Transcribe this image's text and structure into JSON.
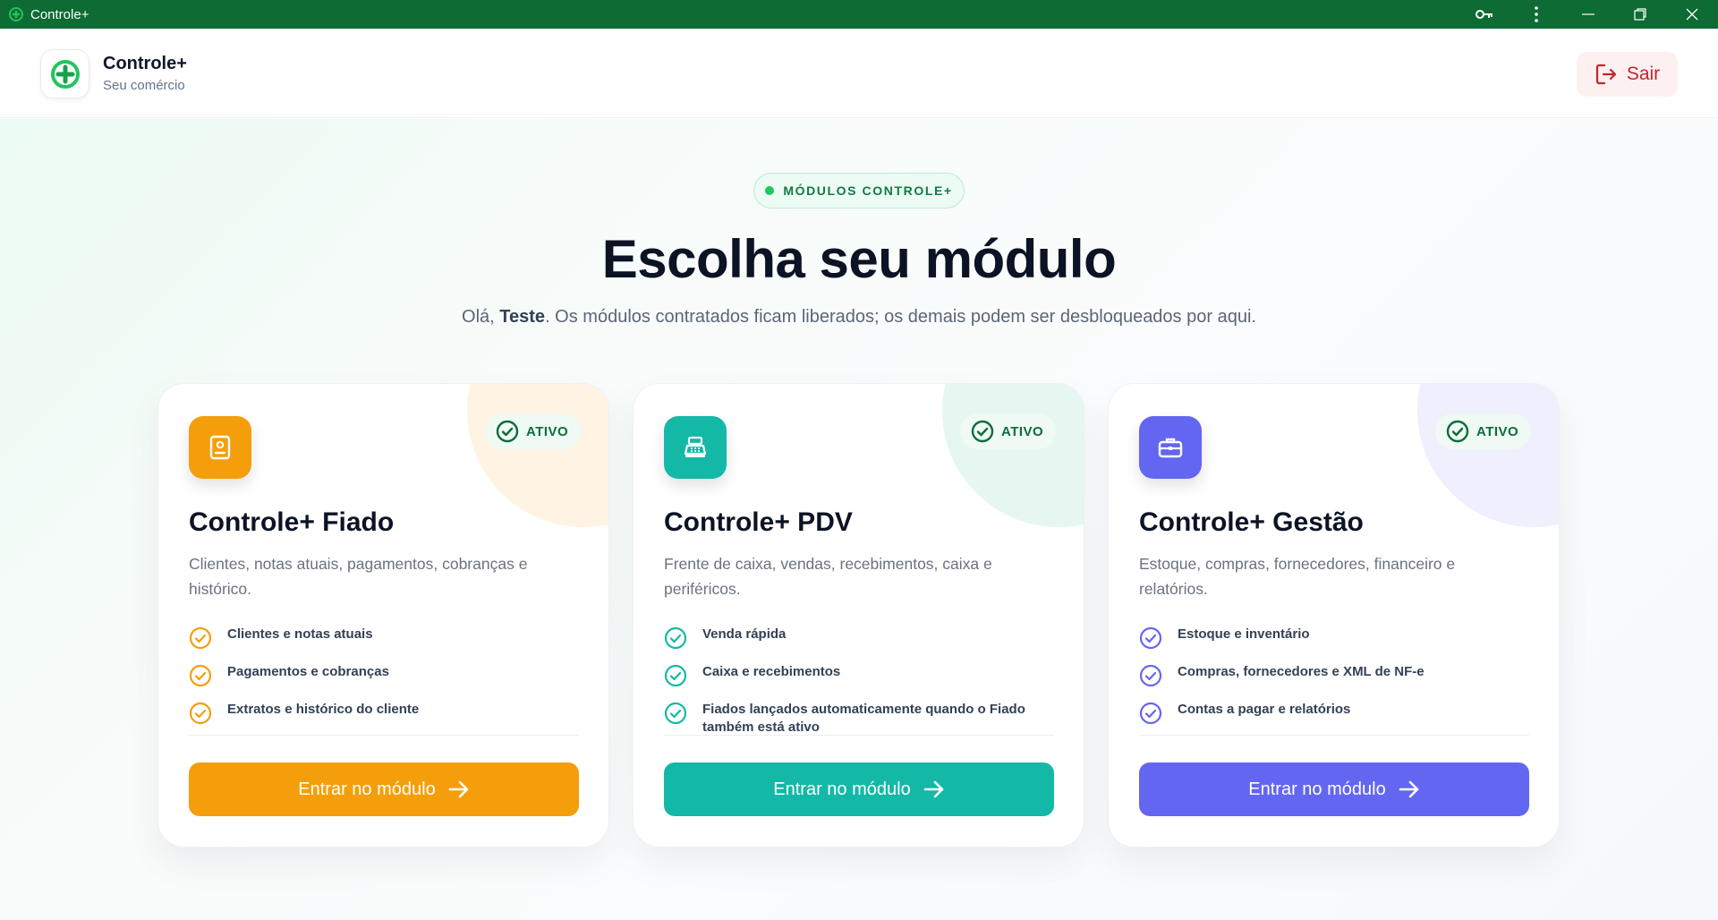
{
  "window": {
    "title": "Controle+",
    "controls": [
      "key-icon",
      "more-vertical-icon",
      "minimize-icon",
      "restore-icon",
      "close-icon"
    ]
  },
  "header": {
    "brand_name": "Controle+",
    "brand_subtitle": "Seu comércio",
    "logout_label": "Sair"
  },
  "hero": {
    "pill_label": "MÓDULOS CONTROLE+",
    "title": "Escolha seu módulo",
    "greeting_prefix": "Olá, ",
    "user_name": "Teste",
    "greeting_suffix": ". Os módulos contratados ficam liberados; os demais podem ser desbloqueados por aqui."
  },
  "modules": [
    {
      "title": "Controle+ Fiado",
      "description": "Clientes, notas atuais, pagamentos, cobranças e histórico.",
      "status": "ATIVO",
      "icon": "contact-card-icon",
      "accent": "#f59e0b",
      "blob": "#fff3e3",
      "features": [
        "Clientes e notas atuais",
        "Pagamentos e cobranças",
        "Extratos e histórico do cliente"
      ],
      "button_label": "Entrar no módulo"
    },
    {
      "title": "Controle+ PDV",
      "description": "Frente de caixa, vendas, recebimentos, caixa e periféricos.",
      "status": "ATIVO",
      "icon": "cash-register-icon",
      "accent": "#14b8a6",
      "blob": "#e6f7f2",
      "features": [
        "Venda rápida",
        "Caixa e recebimentos",
        "Fiados lançados automaticamente quando o Fiado também está ativo"
      ],
      "button_label": "Entrar no módulo"
    },
    {
      "title": "Controle+ Gestão",
      "description": "Estoque, compras, fornecedores, financeiro e relatórios.",
      "status": "ATIVO",
      "icon": "briefcase-icon",
      "accent": "#6366f1",
      "blob": "#efeffd",
      "features": [
        "Estoque e inventário",
        "Compras, fornecedores e XML de NF-e",
        "Contas a pagar e relatórios"
      ],
      "button_label": "Entrar no módulo"
    }
  ]
}
